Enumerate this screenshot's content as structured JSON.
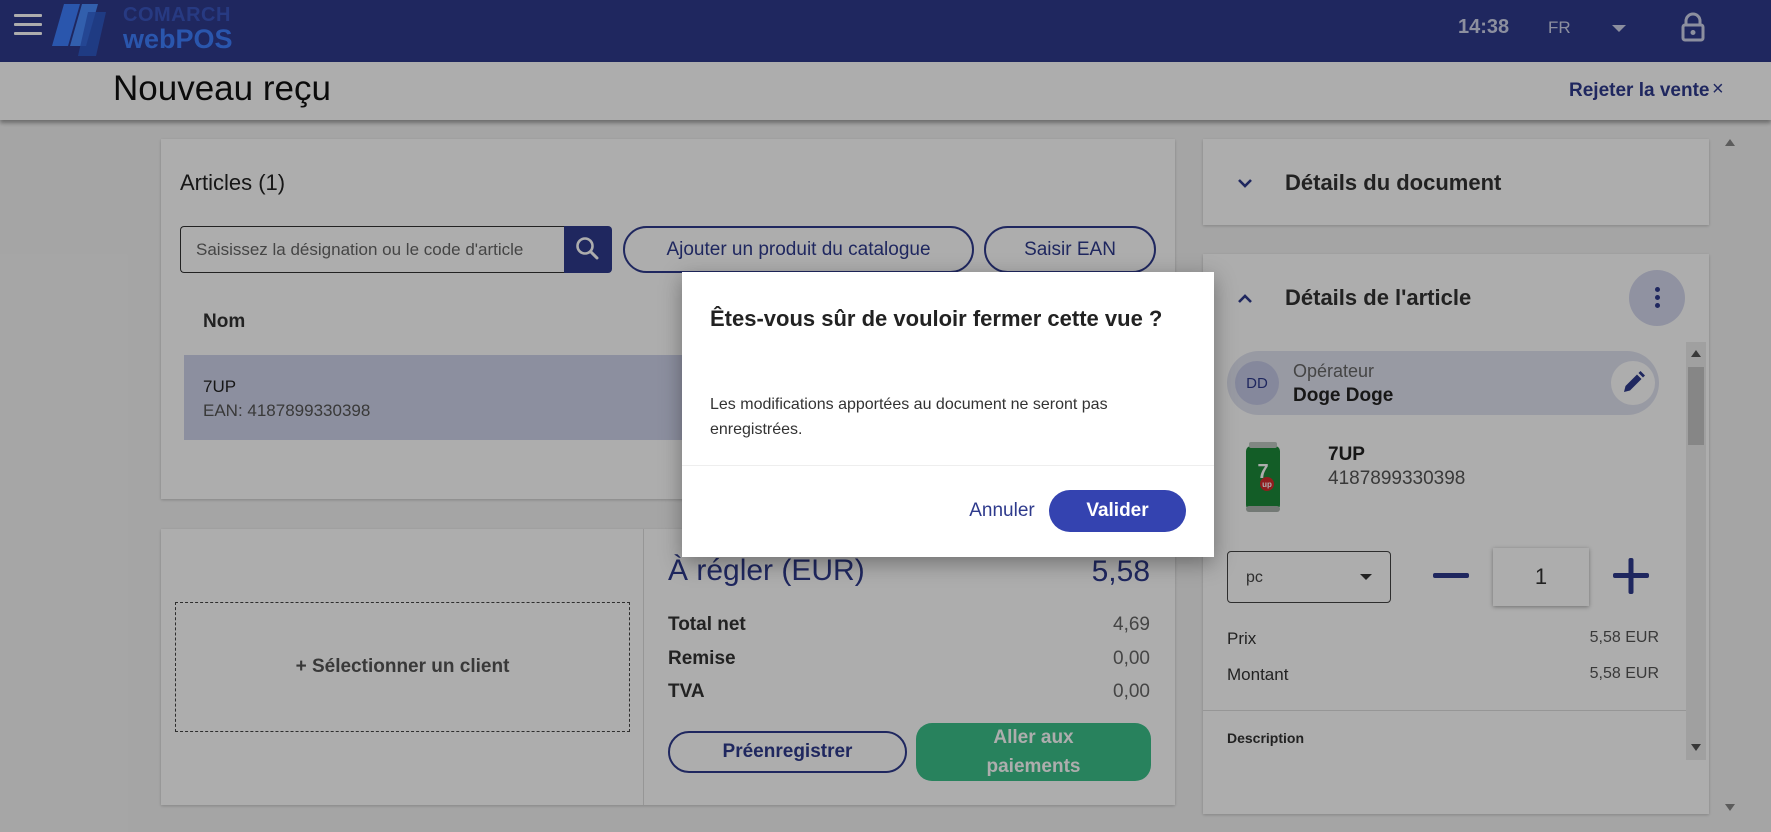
{
  "topbar": {
    "logo_top": "COMARCH",
    "logo_bottom": "webPOS",
    "time": "14:38",
    "language": "FR",
    "menu_icon": "hamburger-menu-icon",
    "lock_icon": "lock-icon"
  },
  "header": {
    "title": "Nouveau reçu",
    "reject_label": "Rejeter la vente",
    "reject_icon": "×"
  },
  "articles": {
    "title": "Articles (1)",
    "search_placeholder": "Saisissez la désignation ou le code d'article",
    "add_catalog_label": "Ajouter un produit du catalogue",
    "ean_label": "Saisir EAN",
    "column_name": "Nom",
    "rows": [
      {
        "name": "7UP",
        "ean": "EAN: 4187899330398"
      }
    ]
  },
  "summary": {
    "select_client_label": "+ Sélectionner un client",
    "due_label": "À régler (EUR)",
    "due_value": "5,58",
    "lines": [
      {
        "label": "Total net",
        "value": "4,69"
      },
      {
        "label": "Remise",
        "value": "0,00"
      },
      {
        "label": "TVA",
        "value": "0,00"
      }
    ],
    "preregister_label": "Préenregistrer",
    "payments_label_line1": "Aller aux",
    "payments_label_line2": "paiements"
  },
  "document_details": {
    "title": "Détails du document"
  },
  "article_details": {
    "title": "Détails de l'article",
    "operator_label": "Opérateur",
    "operator_name": "Doge Doge",
    "operator_initials": "DD",
    "product_name": "7UP",
    "product_ean": "4187899330398",
    "unit": "pc",
    "quantity": "1",
    "price_label": "Prix",
    "price_value": "5,58 EUR",
    "amount_label": "Montant",
    "amount_value": "5,58 EUR",
    "description_label": "Description"
  },
  "dialog": {
    "title": "Êtes-vous sûr de vouloir fermer cette vue ?",
    "message": "Les modifications apportées au document ne seront pas enregistrées.",
    "cancel_label": "Annuler",
    "confirm_label": "Valider"
  },
  "colors": {
    "primary": "#2e3a8c",
    "accent_button": "#3443b0",
    "success": "#3cc08a",
    "selected_row": "#cfd3ea"
  }
}
